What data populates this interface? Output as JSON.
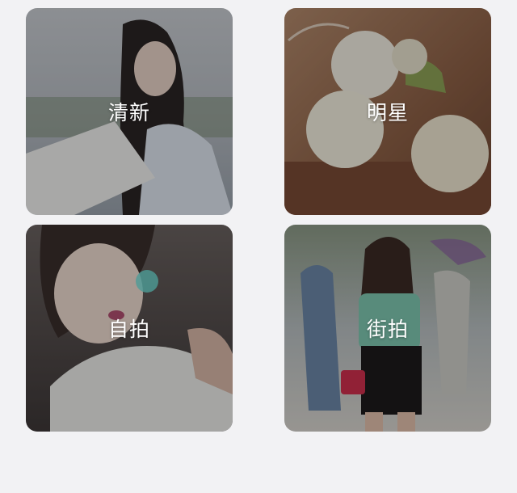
{
  "categories": [
    {
      "label": "清新",
      "image": "fresh-girl-photo"
    },
    {
      "label": "明星",
      "image": "white-roses-photo"
    },
    {
      "label": "自拍",
      "image": "selfie-girl-photo"
    },
    {
      "label": "街拍",
      "image": "street-walk-photo"
    }
  ],
  "colors": {
    "background": "#f2f2f4",
    "label_text": "#ffffff"
  }
}
